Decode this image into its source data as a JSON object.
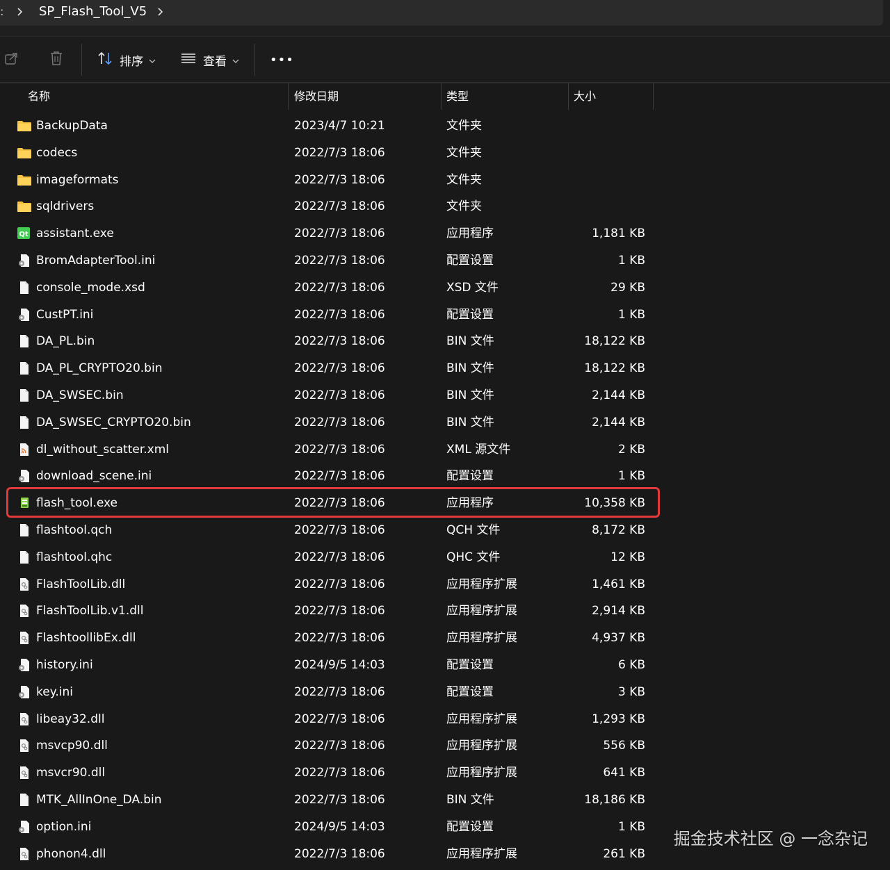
{
  "address_bar": {
    "path": [
      "SP_Flash_Tool_V5"
    ]
  },
  "toolbar": {
    "share_icon": "share-icon",
    "delete_icon": "trash-icon",
    "sort_label": "排序",
    "view_label": "查看",
    "more_label": "•••"
  },
  "columns": {
    "name": "名称",
    "date": "修改日期",
    "type": "类型",
    "size": "大小"
  },
  "files": [
    {
      "name": "BackupData",
      "date": "2023/4/7 10:21",
      "type": "文件夹",
      "size": "",
      "icon": "folder"
    },
    {
      "name": "codecs",
      "date": "2022/7/3 18:06",
      "type": "文件夹",
      "size": "",
      "icon": "folder"
    },
    {
      "name": "imageformats",
      "date": "2022/7/3 18:06",
      "type": "文件夹",
      "size": "",
      "icon": "folder"
    },
    {
      "name": "sqldrivers",
      "date": "2022/7/3 18:06",
      "type": "文件夹",
      "size": "",
      "icon": "folder"
    },
    {
      "name": "assistant.exe",
      "date": "2022/7/3 18:06",
      "type": "应用程序",
      "size": "1,181 KB",
      "icon": "qt"
    },
    {
      "name": "BromAdapterTool.ini",
      "date": "2022/7/3 18:06",
      "type": "配置设置",
      "size": "1 KB",
      "icon": "ini"
    },
    {
      "name": "console_mode.xsd",
      "date": "2022/7/3 18:06",
      "type": "XSD 文件",
      "size": "29 KB",
      "icon": "file"
    },
    {
      "name": "CustPT.ini",
      "date": "2022/7/3 18:06",
      "type": "配置设置",
      "size": "1 KB",
      "icon": "ini"
    },
    {
      "name": "DA_PL.bin",
      "date": "2022/7/3 18:06",
      "type": "BIN 文件",
      "size": "18,122 KB",
      "icon": "file"
    },
    {
      "name": "DA_PL_CRYPTO20.bin",
      "date": "2022/7/3 18:06",
      "type": "BIN 文件",
      "size": "18,122 KB",
      "icon": "file"
    },
    {
      "name": "DA_SWSEC.bin",
      "date": "2022/7/3 18:06",
      "type": "BIN 文件",
      "size": "2,144 KB",
      "icon": "file"
    },
    {
      "name": "DA_SWSEC_CRYPTO20.bin",
      "date": "2022/7/3 18:06",
      "type": "BIN 文件",
      "size": "2,144 KB",
      "icon": "file"
    },
    {
      "name": "dl_without_scatter.xml",
      "date": "2022/7/3 18:06",
      "type": "XML 源文件",
      "size": "2 KB",
      "icon": "xml"
    },
    {
      "name": "download_scene.ini",
      "date": "2022/7/3 18:06",
      "type": "配置设置",
      "size": "1 KB",
      "icon": "ini"
    },
    {
      "name": "flash_tool.exe",
      "date": "2022/7/3 18:06",
      "type": "应用程序",
      "size": "10,358 KB",
      "icon": "exe"
    },
    {
      "name": "flashtool.qch",
      "date": "2022/7/3 18:06",
      "type": "QCH 文件",
      "size": "8,172 KB",
      "icon": "file"
    },
    {
      "name": "flashtool.qhc",
      "date": "2022/7/3 18:06",
      "type": "QHC 文件",
      "size": "12 KB",
      "icon": "file"
    },
    {
      "name": "FlashToolLib.dll",
      "date": "2022/7/3 18:06",
      "type": "应用程序扩展",
      "size": "1,461 KB",
      "icon": "dll"
    },
    {
      "name": "FlashToolLib.v1.dll",
      "date": "2022/7/3 18:06",
      "type": "应用程序扩展",
      "size": "2,914 KB",
      "icon": "dll"
    },
    {
      "name": "FlashtoollibEx.dll",
      "date": "2022/7/3 18:06",
      "type": "应用程序扩展",
      "size": "4,937 KB",
      "icon": "dll"
    },
    {
      "name": "history.ini",
      "date": "2024/9/5 14:03",
      "type": "配置设置",
      "size": "6 KB",
      "icon": "ini"
    },
    {
      "name": "key.ini",
      "date": "2022/7/3 18:06",
      "type": "配置设置",
      "size": "3 KB",
      "icon": "ini"
    },
    {
      "name": "libeay32.dll",
      "date": "2022/7/3 18:06",
      "type": "应用程序扩展",
      "size": "1,293 KB",
      "icon": "dll"
    },
    {
      "name": "msvcp90.dll",
      "date": "2022/7/3 18:06",
      "type": "应用程序扩展",
      "size": "556 KB",
      "icon": "dll"
    },
    {
      "name": "msvcr90.dll",
      "date": "2022/7/3 18:06",
      "type": "应用程序扩展",
      "size": "641 KB",
      "icon": "dll"
    },
    {
      "name": "MTK_AllInOne_DA.bin",
      "date": "2022/7/3 18:06",
      "type": "BIN 文件",
      "size": "18,186 KB",
      "icon": "file"
    },
    {
      "name": "option.ini",
      "date": "2024/9/5 14:03",
      "type": "配置设置",
      "size": "1 KB",
      "icon": "ini"
    },
    {
      "name": "phonon4.dll",
      "date": "2022/7/3 18:06",
      "type": "应用程序扩展",
      "size": "261 KB",
      "icon": "dll"
    }
  ],
  "highlighted_file": "flash_tool.exe",
  "colors": {
    "background": "#191919",
    "highlight_border": "#e23a3a",
    "folder": "#f5c242"
  },
  "watermark": "掘金技术社区 @ 一念杂记"
}
